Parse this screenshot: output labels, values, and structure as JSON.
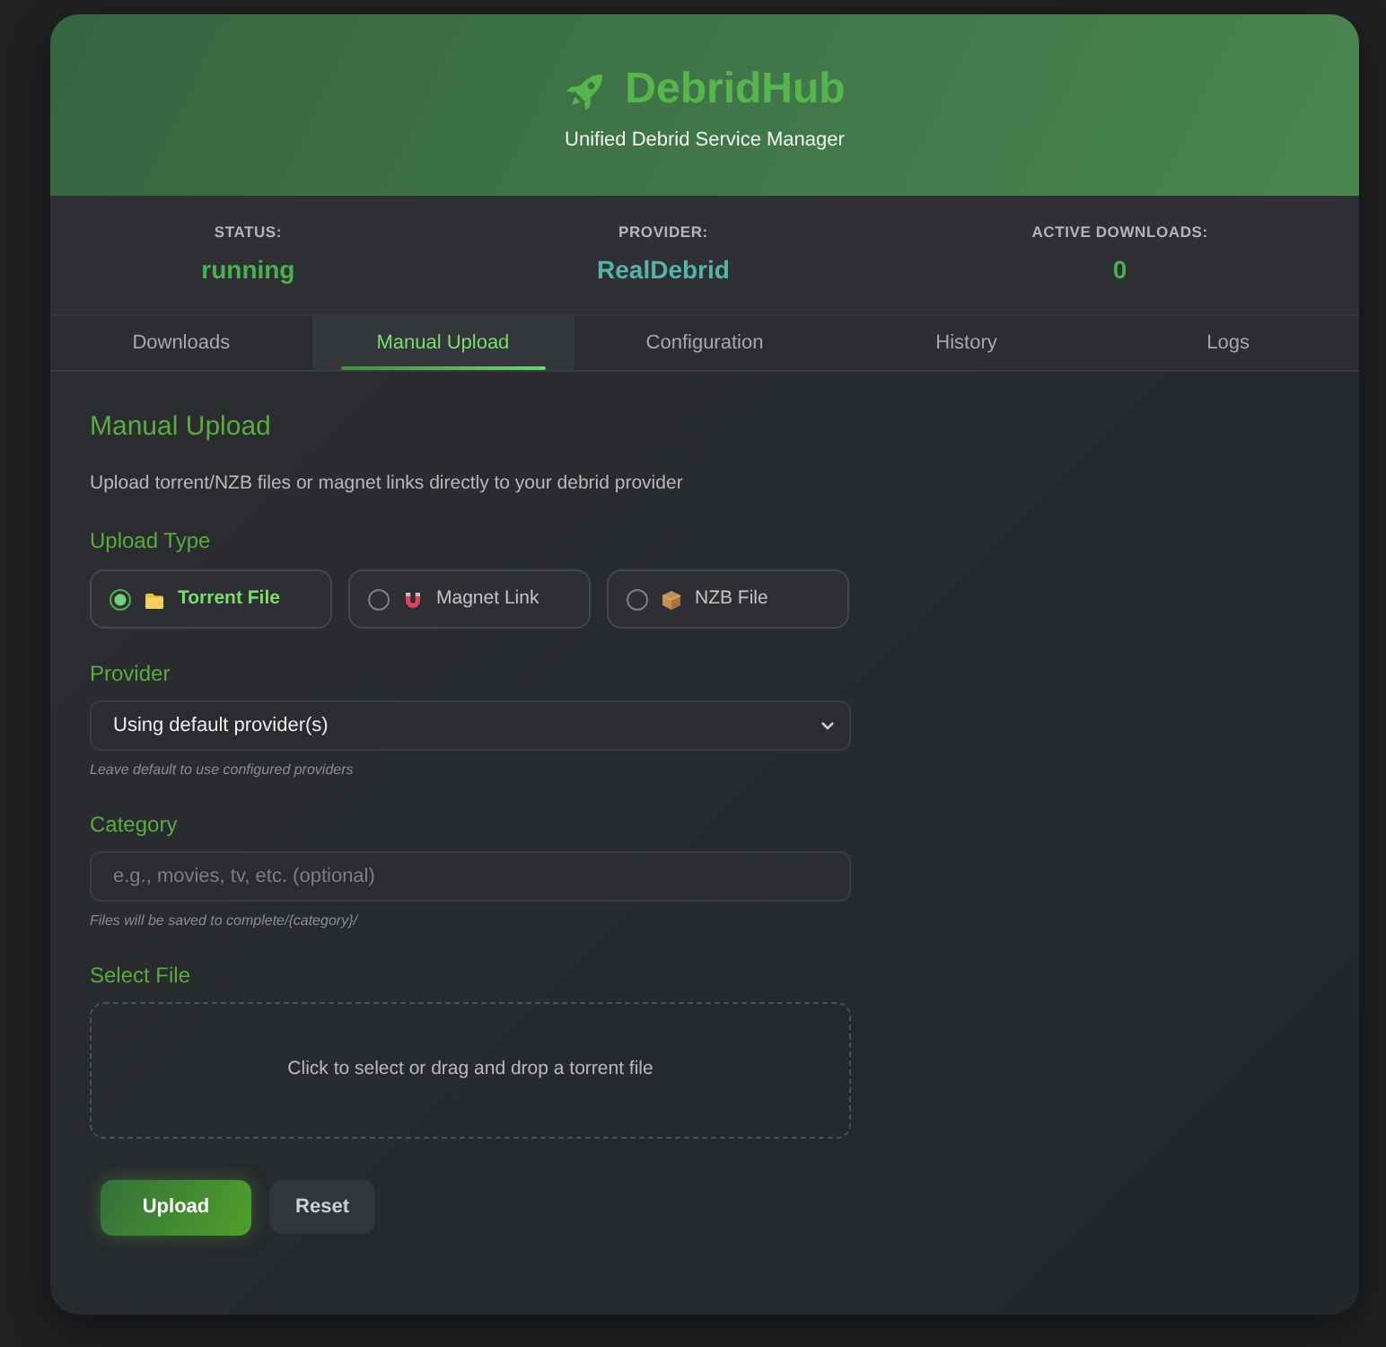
{
  "header": {
    "title": "DebridHub",
    "subtitle": "Unified Debrid Service Manager"
  },
  "stats": [
    {
      "label": "STATUS:",
      "value": "running",
      "color": "#4caf50"
    },
    {
      "label": "PROVIDER:",
      "value": "RealDebrid",
      "color": "#55b3a8"
    },
    {
      "label": "ACTIVE DOWNLOADS:",
      "value": "0",
      "color": "#4caf50"
    }
  ],
  "tabs": [
    {
      "label": "Downloads",
      "selected": false
    },
    {
      "label": "Manual Upload",
      "selected": true
    },
    {
      "label": "Configuration",
      "selected": false
    },
    {
      "label": "History",
      "selected": false
    },
    {
      "label": "Logs",
      "selected": false
    }
  ],
  "upload": {
    "title": "Manual Upload",
    "description": "Upload torrent/NZB files or magnet links directly to your debrid provider",
    "upload_type": {
      "label": "Upload Type",
      "options": [
        {
          "label": "Torrent File",
          "kind": "folder",
          "selected": true
        },
        {
          "label": "Magnet Link",
          "kind": "magnet",
          "selected": false
        },
        {
          "label": "NZB File",
          "kind": "package",
          "selected": false
        }
      ]
    },
    "provider": {
      "label": "Provider",
      "value": "Using default provider(s)",
      "hint": "Leave default to use configured providers"
    },
    "category": {
      "label": "Category",
      "placeholder": "e.g., movies, tv, etc. (optional)",
      "hint": "Files will be saved to complete/{category}/"
    },
    "file": {
      "label": "Select File",
      "prompt": "Click to select or drag and drop a torrent file"
    },
    "buttons": [
      {
        "label": "Upload",
        "kind": "primary"
      },
      {
        "label": "Reset",
        "kind": "secondary"
      }
    ]
  }
}
